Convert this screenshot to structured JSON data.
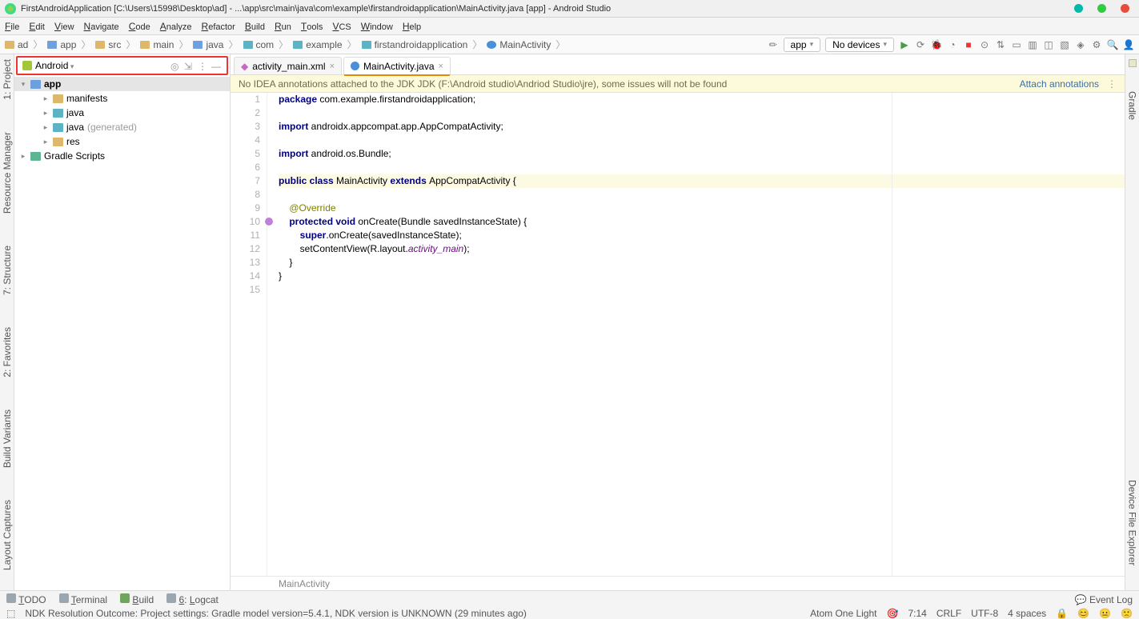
{
  "title": "FirstAndroidApplication [C:\\Users\\15998\\Desktop\\ad] - ...\\app\\src\\main\\java\\com\\example\\firstandroidapplication\\MainActivity.java [app] - Android Studio",
  "menu": [
    "File",
    "Edit",
    "View",
    "Navigate",
    "Code",
    "Analyze",
    "Refactor",
    "Build",
    "Run",
    "Tools",
    "VCS",
    "Window",
    "Help"
  ],
  "breadcrumb": [
    "ad",
    "app",
    "src",
    "main",
    "java",
    "com",
    "example",
    "firstandroidapplication",
    "MainActivity"
  ],
  "run_config": "app",
  "device_sel": "No devices",
  "project_view": "Android",
  "tree": {
    "root": "app",
    "items": [
      {
        "label": "manifests",
        "kind": "dir"
      },
      {
        "label": "java",
        "kind": "pkg"
      },
      {
        "label": "java",
        "suffix": "(generated)",
        "kind": "pkg"
      },
      {
        "label": "res",
        "kind": "res"
      }
    ],
    "gradle": "Gradle Scripts"
  },
  "tabs": [
    {
      "label": "activity_main.xml",
      "active": false,
      "icon": "xml"
    },
    {
      "label": "MainActivity.java",
      "active": true,
      "icon": "class"
    }
  ],
  "banner": {
    "msg": "No IDEA annotations attached to the JDK JDK (F:\\Android studio\\Andriod Studio\\jre), some issues will not be found",
    "action": "Attach annotations"
  },
  "code": {
    "lines": [
      {
        "n": 1,
        "seg": [
          {
            "t": "package ",
            "c": "kw"
          },
          {
            "t": "com.example.firstandroidapplication;",
            "c": ""
          }
        ]
      },
      {
        "n": 2,
        "seg": []
      },
      {
        "n": 3,
        "seg": [
          {
            "t": "import ",
            "c": "kw"
          },
          {
            "t": "androidx.appcompat.app.AppCompatActivity;",
            "c": ""
          }
        ]
      },
      {
        "n": 4,
        "seg": []
      },
      {
        "n": 5,
        "seg": [
          {
            "t": "import ",
            "c": "kw"
          },
          {
            "t": "android.os.Bundle;",
            "c": ""
          }
        ]
      },
      {
        "n": 6,
        "seg": []
      },
      {
        "n": 7,
        "hl": true,
        "seg": [
          {
            "t": "public class ",
            "c": "kw"
          },
          {
            "t": "MainActivity",
            "c": "cursorbox"
          },
          {
            "t": " ",
            "c": ""
          },
          {
            "t": "extends ",
            "c": "kw"
          },
          {
            "t": "AppCompatActivity {",
            "c": ""
          }
        ]
      },
      {
        "n": 8,
        "seg": []
      },
      {
        "n": 9,
        "seg": [
          {
            "t": "    ",
            "c": ""
          },
          {
            "t": "@Override",
            "c": "ann"
          }
        ]
      },
      {
        "n": 10,
        "mark": true,
        "seg": [
          {
            "t": "    ",
            "c": ""
          },
          {
            "t": "protected void ",
            "c": "kw"
          },
          {
            "t": "onCreate(Bundle savedInstanceState) {",
            "c": ""
          }
        ]
      },
      {
        "n": 11,
        "seg": [
          {
            "t": "        ",
            "c": ""
          },
          {
            "t": "super",
            "c": "kw"
          },
          {
            "t": ".onCreate(savedInstanceState);",
            "c": ""
          }
        ]
      },
      {
        "n": 12,
        "seg": [
          {
            "t": "        setContentView(R.layout.",
            "c": ""
          },
          {
            "t": "activity_main",
            "c": "str-it"
          },
          {
            "t": ");",
            "c": ""
          }
        ]
      },
      {
        "n": 13,
        "seg": [
          {
            "t": "    }",
            "c": ""
          }
        ]
      },
      {
        "n": 14,
        "seg": [
          {
            "t": "}",
            "c": ""
          }
        ]
      },
      {
        "n": 15,
        "seg": []
      }
    ]
  },
  "editor_crumb": "MainActivity",
  "left_strips": [
    {
      "num": "1:",
      "label": "Project"
    },
    {
      "num": "7:",
      "label": "Structure"
    },
    {
      "num": "2:",
      "label": "Favorites"
    },
    {
      "num": "",
      "label": "Build Variants"
    },
    {
      "num": "",
      "label": "Layout Captures"
    },
    {
      "num": "",
      "label": "Resource Manager"
    }
  ],
  "right_strips": [
    "Gradle",
    "Device File Explorer"
  ],
  "tool_tabs": [
    {
      "label": "TODO",
      "icon": "i-todo"
    },
    {
      "label": "Terminal",
      "icon": "i-term"
    },
    {
      "label": "Build",
      "icon": "i-build"
    },
    {
      "label": "Logcat",
      "icon": "i-logcat",
      "prefix": "6:"
    }
  ],
  "event_log": "Event Log",
  "status": {
    "msg": "NDK Resolution Outcome: Project settings: Gradle model version=5.4.1, NDK version is UNKNOWN (29 minutes ago)",
    "scheme": "Atom One Light",
    "pos": "7:14",
    "eol": "CRLF",
    "enc": "UTF-8",
    "indent": "4 spaces"
  }
}
